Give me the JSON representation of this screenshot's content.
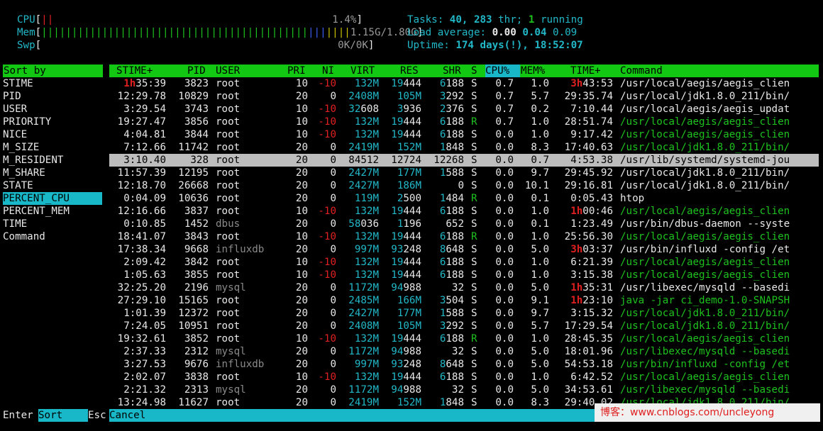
{
  "meters": {
    "cpu": {
      "label": "CPU",
      "bar": "||",
      "value": "1.4%"
    },
    "mem": {
      "label": "Mem",
      "bar_green": "||||||||||||||||||||||||||||||||||||||||||||",
      "bar_blue": "|||",
      "bar_yellow": "||||",
      "value": "1.15G/1.80G"
    },
    "swp": {
      "label": "Swp",
      "value": "0K/0K"
    }
  },
  "summary": {
    "tasks_label": "Tasks:",
    "tasks": "40,",
    "threads": "283",
    "thr_label": "thr;",
    "running": "1",
    "running_label": "running",
    "load_label": "Load average:",
    "load1": "0.00",
    "load5": "0.04",
    "load15": "0.09",
    "uptime_label": "Uptime:",
    "uptime": "174 days(!), 18:52:07"
  },
  "sort_panel": {
    "title": "Sort by",
    "items": [
      "STIME",
      "PID",
      "USER",
      "PRIORITY",
      "NICE",
      "M_SIZE",
      "M_RESIDENT",
      "M_SHARE",
      "STATE",
      "PERCENT_CPU",
      "PERCENT_MEM",
      "TIME",
      "Command"
    ],
    "selected": "PERCENT_CPU"
  },
  "columns": [
    "STIME+",
    "PID",
    "USER",
    "PRI",
    "NI",
    "VIRT",
    "RES",
    "SHR",
    "S",
    "CPU%",
    "MEM%",
    "TIME+",
    "Command"
  ],
  "sorted_column": "CPU%",
  "processes": [
    {
      "stime_h": "1h",
      "stime": "35:39",
      "pid": "3823",
      "user": "root",
      "pri": "10",
      "ni": "-10",
      "virt": "132M",
      "res": "19444",
      "shr": "6188",
      "s": "S",
      "cpu": "0.7",
      "mem": "1.0",
      "time_h": "3h",
      "time": "43:53",
      "cmd": "/usr/local/aegis/aegis_clien",
      "cmd_color": "w"
    },
    {
      "stime": "12:29.78",
      "pid": "10829",
      "user": "root",
      "pri": "20",
      "ni": "0",
      "virt": "2408M",
      "res": "105M",
      "shr": "3292",
      "s": "S",
      "cpu": "0.7",
      "mem": "5.7",
      "time": "29:35.74",
      "cmd": "/usr/local/jdk1.8.0_211/bin/",
      "cmd_color": "w"
    },
    {
      "stime": "3:29.54",
      "pid": "3743",
      "user": "root",
      "pri": "10",
      "ni": "-10",
      "virt": "32608",
      "res": "3936",
      "shr": "2376",
      "s": "S",
      "cpu": "0.7",
      "mem": "0.2",
      "time": "7:10.44",
      "cmd": "/usr/local/aegis/aegis_updat",
      "cmd_color": "w"
    },
    {
      "stime": "19:27.47",
      "pid": "3856",
      "user": "root",
      "pri": "10",
      "ni": "-10",
      "virt": "132M",
      "res": "19444",
      "shr": "6188",
      "s": "R",
      "cpu": "0.7",
      "mem": "1.0",
      "time": "28:51.74",
      "cmd": "/usr/local/aegis/aegis_clien",
      "cmd_color": "g"
    },
    {
      "stime": "4:04.81",
      "pid": "3844",
      "user": "root",
      "pri": "10",
      "ni": "-10",
      "virt": "132M",
      "res": "19444",
      "shr": "6188",
      "s": "S",
      "cpu": "0.0",
      "mem": "1.0",
      "time": "9:17.42",
      "cmd": "/usr/local/aegis/aegis_clien",
      "cmd_color": "g"
    },
    {
      "stime": "7:12.66",
      "pid": "11742",
      "user": "root",
      "pri": "20",
      "ni": "0",
      "virt": "2419M",
      "res": "152M",
      "shr": "1848",
      "s": "S",
      "cpu": "0.0",
      "mem": "8.3",
      "time": "17:40.63",
      "cmd": "/usr/local/jdk1.8.0_211/bin/",
      "cmd_color": "g"
    },
    {
      "stime": "3:10.40",
      "pid": "328",
      "user": "root",
      "pri": "20",
      "ni": "0",
      "virt": "84512",
      "res": "12724",
      "shr": "12268",
      "s": "S",
      "cpu": "0.0",
      "mem": "0.7",
      "time": "4:53.38",
      "cmd": "/usr/lib/systemd/systemd-jou",
      "cmd_color": "w",
      "selected": true
    },
    {
      "stime": "11:57.39",
      "pid": "12195",
      "user": "root",
      "pri": "20",
      "ni": "0",
      "virt": "2427M",
      "res": "177M",
      "shr": "1588",
      "s": "S",
      "cpu": "0.0",
      "mem": "9.7",
      "time": "29:45.92",
      "cmd": "/usr/local/jdk1.8.0_211/bin/",
      "cmd_color": "w"
    },
    {
      "stime": "12:18.70",
      "pid": "26668",
      "user": "root",
      "pri": "20",
      "ni": "0",
      "virt": "2427M",
      "res": "186M",
      "shr": "0",
      "s": "S",
      "cpu": "0.0",
      "mem": "10.1",
      "time": "29:16.81",
      "cmd": "/usr/local/jdk1.8.0_211/bin/",
      "cmd_color": "w"
    },
    {
      "stime": "0:04.09",
      "pid": "10636",
      "user": "root",
      "pri": "20",
      "ni": "0",
      "virt": "119M",
      "res": "2500",
      "shr": "1484",
      "s": "R",
      "cpu": "0.0",
      "mem": "0.1",
      "time": "0:05.43",
      "cmd": "htop",
      "cmd_color": "w"
    },
    {
      "stime": "12:16.66",
      "pid": "3837",
      "user": "root",
      "pri": "10",
      "ni": "-10",
      "virt": "132M",
      "res": "19444",
      "shr": "6188",
      "s": "S",
      "cpu": "0.0",
      "mem": "1.0",
      "time_h": "1h",
      "time": "00:46",
      "cmd": "/usr/local/aegis/aegis_clien",
      "cmd_color": "g"
    },
    {
      "stime": "0:10.85",
      "pid": "1452",
      "user": "dbus",
      "pri": "20",
      "ni": "0",
      "virt": "58036",
      "res": "1196",
      "shr": "652",
      "s": "S",
      "cpu": "0.0",
      "mem": "0.1",
      "time": "1:23.49",
      "cmd": "/usr/bin/dbus-daemon --syste",
      "cmd_color": "w"
    },
    {
      "stime": "18:41.07",
      "pid": "3843",
      "user": "root",
      "pri": "10",
      "ni": "-10",
      "virt": "132M",
      "res": "19444",
      "shr": "6188",
      "s": "R",
      "cpu": "0.0",
      "mem": "1.0",
      "time": "25:56.30",
      "cmd": "/usr/local/aegis/aegis_clien",
      "cmd_color": "g"
    },
    {
      "stime": "17:38.34",
      "pid": "9668",
      "user": "influxdb",
      "pri": "20",
      "ni": "0",
      "virt": "997M",
      "res": "93248",
      "shr": "8648",
      "s": "S",
      "cpu": "0.0",
      "mem": "5.0",
      "time_h": "3h",
      "time": "03:37",
      "cmd": "/usr/bin/influxd -config /et",
      "cmd_color": "w"
    },
    {
      "stime": "2:09.42",
      "pid": "3842",
      "user": "root",
      "pri": "10",
      "ni": "-10",
      "virt": "132M",
      "res": "19444",
      "shr": "6188",
      "s": "S",
      "cpu": "0.0",
      "mem": "1.0",
      "time": "6:21.39",
      "cmd": "/usr/local/aegis/aegis_clien",
      "cmd_color": "g"
    },
    {
      "stime": "1:05.63",
      "pid": "3855",
      "user": "root",
      "pri": "10",
      "ni": "-10",
      "virt": "132M",
      "res": "19444",
      "shr": "6188",
      "s": "S",
      "cpu": "0.0",
      "mem": "1.0",
      "time": "3:15.38",
      "cmd": "/usr/local/aegis/aegis_clien",
      "cmd_color": "g"
    },
    {
      "stime": "32:25.20",
      "pid": "2196",
      "user": "mysql",
      "pri": "20",
      "ni": "0",
      "virt": "1172M",
      "res": "94988",
      "shr": "32",
      "s": "S",
      "cpu": "0.0",
      "mem": "5.0",
      "time_h": "1h",
      "time": "35:31",
      "cmd": "/usr/libexec/mysqld --basedi",
      "cmd_color": "w"
    },
    {
      "stime": "27:29.10",
      "pid": "15165",
      "user": "root",
      "pri": "20",
      "ni": "0",
      "virt": "2485M",
      "res": "166M",
      "shr": "3504",
      "s": "S",
      "cpu": "0.0",
      "mem": "9.1",
      "time_h": "1h",
      "time": "23:10",
      "cmd": "java -jar ci_demo-1.0-SNAPSH",
      "cmd_color": "g"
    },
    {
      "stime": "1:01.39",
      "pid": "12372",
      "user": "root",
      "pri": "20",
      "ni": "0",
      "virt": "2427M",
      "res": "177M",
      "shr": "1588",
      "s": "S",
      "cpu": "0.0",
      "mem": "9.7",
      "time": "3:15.32",
      "cmd": "/usr/local/jdk1.8.0_211/bin/",
      "cmd_color": "g"
    },
    {
      "stime": "7:24.05",
      "pid": "10951",
      "user": "root",
      "pri": "20",
      "ni": "0",
      "virt": "2408M",
      "res": "105M",
      "shr": "3292",
      "s": "S",
      "cpu": "0.0",
      "mem": "5.7",
      "time": "17:29.54",
      "cmd": "/usr/local/jdk1.8.0_211/bin/",
      "cmd_color": "g"
    },
    {
      "stime": "19:32.61",
      "pid": "3852",
      "user": "root",
      "pri": "10",
      "ni": "-10",
      "virt": "132M",
      "res": "19444",
      "shr": "6188",
      "s": "R",
      "cpu": "0.0",
      "mem": "1.0",
      "time": "28:45.35",
      "cmd": "/usr/local/aegis/aegis_clien",
      "cmd_color": "g"
    },
    {
      "stime": "2:37.33",
      "pid": "2312",
      "user": "mysql",
      "pri": "20",
      "ni": "0",
      "virt": "1172M",
      "res": "94988",
      "shr": "32",
      "s": "S",
      "cpu": "0.0",
      "mem": "5.0",
      "time": "18:01.96",
      "cmd": "/usr/libexec/mysqld --basedi",
      "cmd_color": "g"
    },
    {
      "stime": "3:27.53",
      "pid": "9676",
      "user": "influxdb",
      "pri": "20",
      "ni": "0",
      "virt": "997M",
      "res": "93248",
      "shr": "8648",
      "s": "S",
      "cpu": "0.0",
      "mem": "5.0",
      "time": "54:53.18",
      "cmd": "/usr/bin/influxd -config /et",
      "cmd_color": "g"
    },
    {
      "stime": "2:02.07",
      "pid": "3838",
      "user": "root",
      "pri": "10",
      "ni": "-10",
      "virt": "132M",
      "res": "19444",
      "shr": "6188",
      "s": "S",
      "cpu": "0.0",
      "mem": "1.0",
      "time": "6:42.52",
      "cmd": "/usr/local/aegis/aegis_clien",
      "cmd_color": "g"
    },
    {
      "stime": "2:21.32",
      "pid": "2313",
      "user": "mysql",
      "pri": "20",
      "ni": "0",
      "virt": "1172M",
      "res": "94988",
      "shr": "32",
      "s": "S",
      "cpu": "0.0",
      "mem": "5.0",
      "time": "34:53.61",
      "cmd": "/usr/libexec/mysqld --basedi",
      "cmd_color": "g"
    },
    {
      "stime": "13:24.98",
      "pid": "11627",
      "user": "root",
      "pri": "20",
      "ni": "0",
      "virt": "2419M",
      "res": "152M",
      "shr": "1848",
      "s": "S",
      "cpu": "0.0",
      "mem": "8.3",
      "time": "29:40.02",
      "cmd": "/usr/local/jdk1.8.0_211/bin/",
      "cmd_color": "g"
    }
  ],
  "footer": [
    {
      "key": "Enter",
      "action": "Sort"
    },
    {
      "key": "Esc",
      "action": "Cancel"
    }
  ],
  "watermark": "博客：www.cnblogs.com/uncleyong",
  "colors": {
    "green": "#12c812",
    "cyan": "#18b8c8",
    "red": "#e02020",
    "selected_row": "#bdbdbd"
  }
}
